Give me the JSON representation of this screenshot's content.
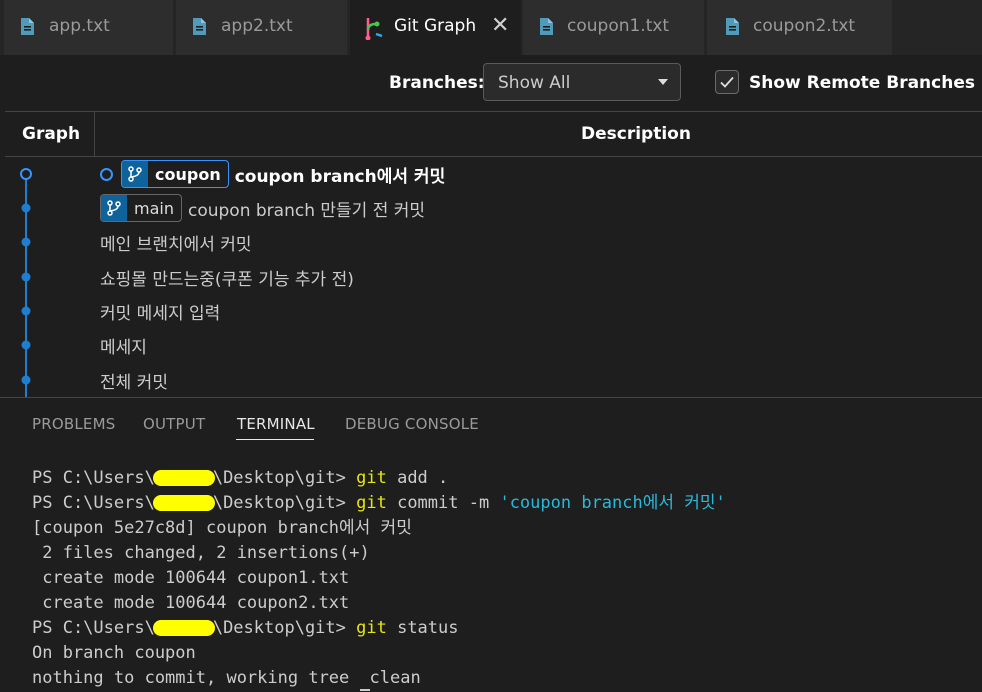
{
  "tabs": [
    {
      "label": "app.txt",
      "icon": "file-icon"
    },
    {
      "label": "app2.txt",
      "icon": "file-icon"
    },
    {
      "label": "Git Graph",
      "icon": "git-graph-icon",
      "active": true
    },
    {
      "label": "coupon1.txt",
      "icon": "file-icon"
    },
    {
      "label": "coupon2.txt",
      "icon": "file-icon"
    }
  ],
  "controls": {
    "branches_label": "Branches:",
    "branches_value": "Show All",
    "show_remote_label": "Show Remote Branches",
    "show_remote_checked": true
  },
  "table": {
    "graph_header": "Graph",
    "description_header": "Description"
  },
  "commits": [
    {
      "ref": "coupon",
      "message": "coupon branch에서 커밋",
      "head": true
    },
    {
      "ref": "main",
      "message": "coupon branch 만들기 전 커밋"
    },
    {
      "message": "메인 브랜치에서 커밋"
    },
    {
      "message": "쇼핑몰 만드는중(쿠폰 기능 추가 전)"
    },
    {
      "message": "커밋 메세지 입력"
    },
    {
      "message": "메세지"
    },
    {
      "message": "전체 커밋"
    }
  ],
  "panel": {
    "tabs": [
      "PROBLEMS",
      "OUTPUT",
      "TERMINAL",
      "DEBUG CONSOLE"
    ],
    "active_tab": "TERMINAL"
  },
  "terminal": {
    "prompt_prefix": "PS C:\\Users\\",
    "prompt_suffix": "\\Desktop\\git> ",
    "cmd1_git": "git",
    "cmd1_rest": " add .",
    "cmd2_git": "git",
    "cmd2_rest": " commit ",
    "cmd2_flag": "-m",
    "cmd2_str": " 'coupon branch에서 커밋'",
    "out1": "[coupon 5e27c8d] coupon branch에서 커밋",
    "out2": " 2 files changed, 2 insertions(+)",
    "out3": " create mode 100644 coupon1.txt",
    "out4": " create mode 100644 coupon2.txt",
    "cmd3_git": "git",
    "cmd3_rest": " status",
    "out5": "On branch coupon",
    "out6": "nothing to commit, working tree",
    "out6_tail": "clean"
  },
  "colors": {
    "accent": "#3794ff",
    "ref_icon_bg": "#0e639c",
    "terminal_command": "#e5e510",
    "terminal_string": "#29b8db",
    "redaction": "#ffff00"
  }
}
